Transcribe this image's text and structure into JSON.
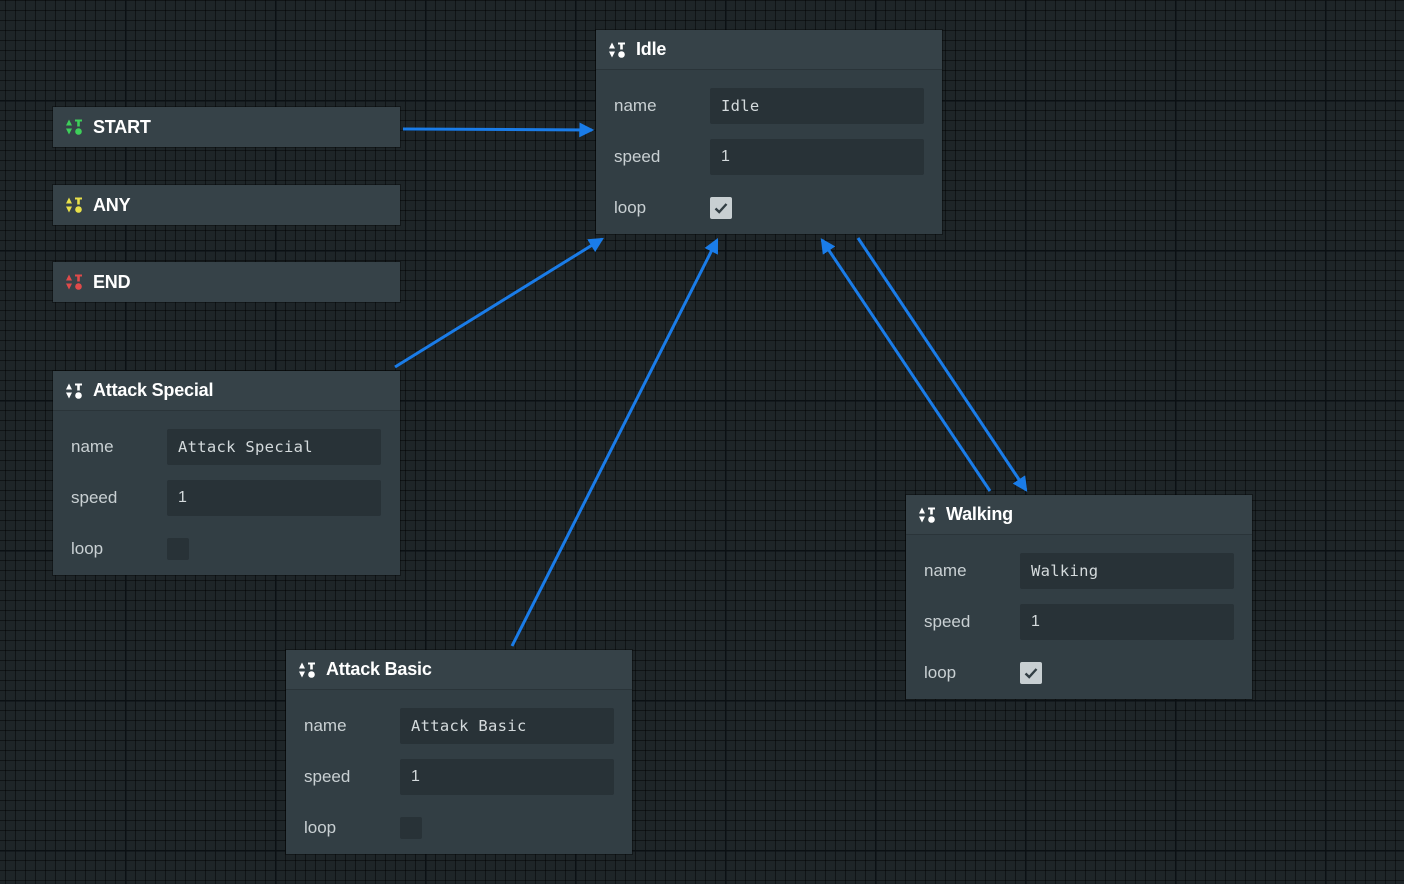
{
  "colors": {
    "edge": "#1a7ce8",
    "start_icon": "#3ecf5a",
    "any_icon": "#e8e04a",
    "end_icon": "#e04a4a",
    "state_icon": "#ffffff"
  },
  "labels": {
    "name": "name",
    "speed": "speed",
    "loop": "loop"
  },
  "entry_nodes": [
    {
      "id": "start",
      "title": "START",
      "icon": "sort-icon-green"
    },
    {
      "id": "any",
      "title": "ANY",
      "icon": "sort-icon-yellow"
    },
    {
      "id": "end",
      "title": "END",
      "icon": "sort-icon-red"
    }
  ],
  "states": {
    "idle": {
      "title": "Idle",
      "name": "Idle",
      "speed": "1",
      "loop": true
    },
    "attack_special": {
      "title": "Attack Special",
      "name": "Attack Special",
      "speed": "1",
      "loop": false
    },
    "attack_basic": {
      "title": "Attack Basic",
      "name": "Attack Basic",
      "speed": "1",
      "loop": false
    },
    "walking": {
      "title": "Walking",
      "name": "Walking",
      "speed": "1",
      "loop": true
    }
  },
  "transitions": [
    {
      "from": "START",
      "to": "Idle"
    },
    {
      "from": "Attack Special",
      "to": "Idle"
    },
    {
      "from": "Attack Basic",
      "to": "Idle"
    },
    {
      "from": "Walking",
      "to": "Idle"
    },
    {
      "from": "Idle",
      "to": "Walking"
    }
  ]
}
